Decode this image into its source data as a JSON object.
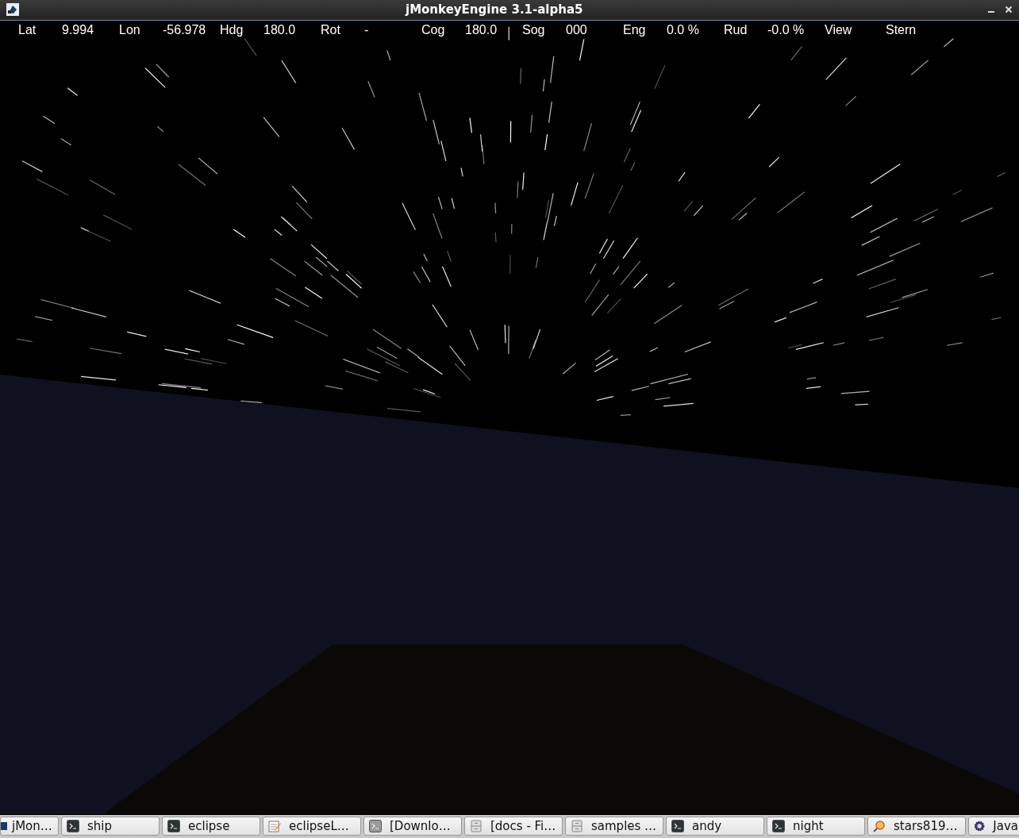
{
  "window": {
    "title": "jMonkeyEngine 3.1-alpha5"
  },
  "hud": [
    {
      "label": "Lat",
      "value": "9.994"
    },
    {
      "label": "Lon",
      "value": "-56.978"
    },
    {
      "label": "Hdg",
      "value": "180.0"
    },
    {
      "label": "Rot",
      "value": "-"
    },
    {
      "label": "Cog",
      "value": "180.0"
    },
    {
      "label": "Sog",
      "value": "000"
    },
    {
      "label": "Eng",
      "value": "0.0 %"
    },
    {
      "label": "Rud",
      "value": "-0.0 %"
    },
    {
      "label": "View",
      "value": "Stern"
    }
  ],
  "taskbar": [
    {
      "label": "jMon…",
      "kind": "app"
    },
    {
      "label": "ship",
      "kind": "terminal"
    },
    {
      "label": "eclipse",
      "kind": "terminal"
    },
    {
      "label": "eclipseL…",
      "kind": "editor"
    },
    {
      "label": "[Downlo…",
      "kind": "terminal-grey"
    },
    {
      "label": "[docs - Fi…",
      "kind": "cabinet"
    },
    {
      "label": "samples …",
      "kind": "cabinet"
    },
    {
      "label": "andy",
      "kind": "terminal"
    },
    {
      "label": "night",
      "kind": "terminal"
    },
    {
      "label": "stars819…",
      "kind": "viewer"
    },
    {
      "label": "Java",
      "kind": "gear"
    }
  ]
}
